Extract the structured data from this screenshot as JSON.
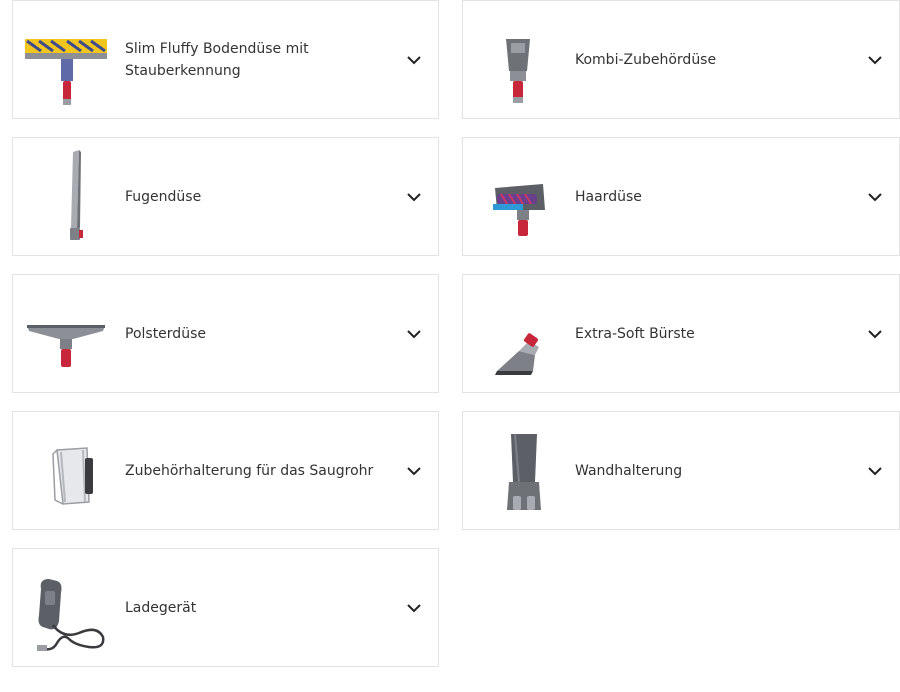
{
  "accessories": [
    {
      "label": "Slim Fluffy Bodendüse mit Stauberkennung",
      "icon": "fluffy-floor-head-icon"
    },
    {
      "label": "Kombi-Zubehördüse",
      "icon": "combination-tool-icon"
    },
    {
      "label": "Fugendüse",
      "icon": "crevice-tool-icon"
    },
    {
      "label": "Haardüse",
      "icon": "hair-screw-tool-icon"
    },
    {
      "label": "Polsterdüse",
      "icon": "upholstery-tool-icon"
    },
    {
      "label": "Extra-Soft Bürste",
      "icon": "soft-brush-icon"
    },
    {
      "label": "Zubehörhalterung für das Saugrohr",
      "icon": "accessory-clip-icon"
    },
    {
      "label": "Wandhalterung",
      "icon": "wall-dock-icon"
    },
    {
      "label": "Ladegerät",
      "icon": "charger-icon"
    }
  ],
  "colors": {
    "border": "#e3e3e3",
    "text": "#333333",
    "accent_red": "#c8263a",
    "accent_yellow": "#f3c61e",
    "accent_blue": "#3f4c8c",
    "metal": "#9a9da3"
  }
}
